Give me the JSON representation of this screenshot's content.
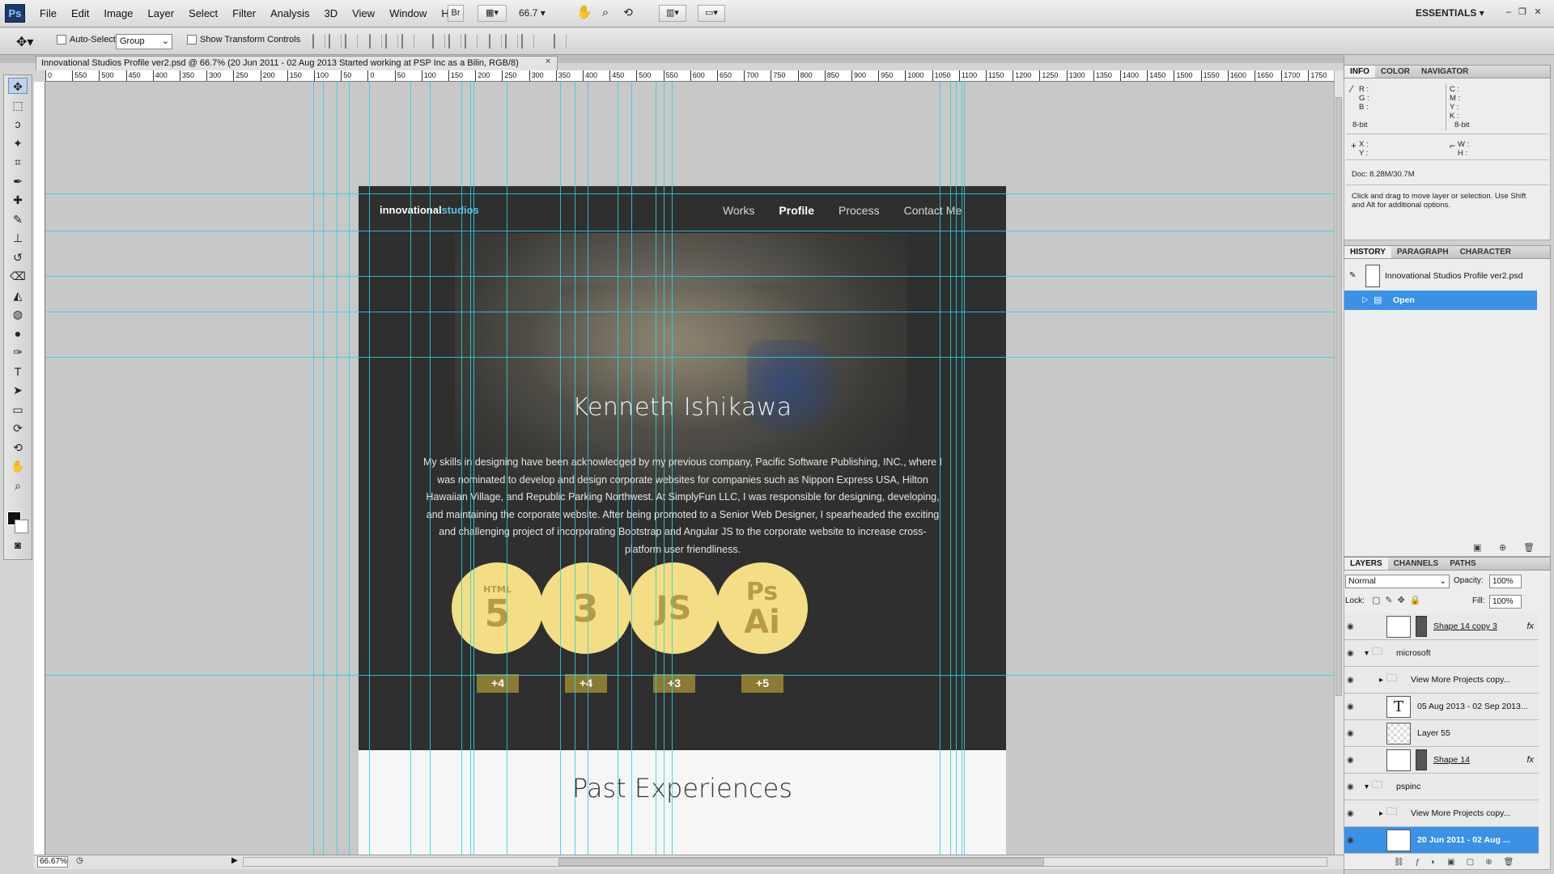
{
  "app": {
    "logo": "Ps",
    "menus": [
      "File",
      "Edit",
      "Image",
      "Layer",
      "Select",
      "Filter",
      "Analysis",
      "3D",
      "View",
      "Window",
      "Help"
    ],
    "zoom_level": "66.7",
    "workspace": "ESSENTIALS",
    "mini_bridge": "Br"
  },
  "options": {
    "auto_select_label": "Auto-Select:",
    "auto_select_value": "Group",
    "transform_label": "Show Transform Controls"
  },
  "document": {
    "tab_title": "Innovational Studios Profile ver2.psd @ 66.7% (20 Jun 2011 - 02 Aug 2013 Started working at PSP Inc as a Bilin, RGB/8)",
    "close": "×",
    "zoom_readout": "66.67%",
    "ruler_labels": [
      "0",
      "550",
      "500",
      "450",
      "400",
      "350",
      "300",
      "250",
      "200",
      "150",
      "100",
      "50",
      "0",
      "50",
      "100",
      "150",
      "200",
      "250",
      "300",
      "350",
      "400",
      "450",
      "500",
      "550",
      "600",
      "650",
      "700",
      "750",
      "800",
      "850",
      "900",
      "950",
      "1000",
      "1050",
      "1100",
      "1150",
      "1200",
      "1250",
      "1300",
      "1350",
      "1400",
      "1450",
      "1500",
      "1550",
      "1600",
      "1650",
      "1700",
      "1750"
    ]
  },
  "design": {
    "logo_a": "innovational",
    "logo_b": "studios",
    "nav": [
      {
        "label": "Works",
        "active": false
      },
      {
        "label": "Profile",
        "active": true
      },
      {
        "label": "Process",
        "active": false
      },
      {
        "label": "Contact Me",
        "active": false
      }
    ],
    "hero_name": "Kenneth Ishikawa",
    "bio": "My skills in designing have been acknowledged by my previous company, Pacific Software Publishing, INC., where I was nominated to develop and design corporate websites for companies such as Nippon Express USA, Hilton Hawaiian Village, and Republic Parking Northwest.  At SimplyFun LLC, I was responsible for designing, developing, and maintaining the corporate website. After being promoted to a Senior Web Designer, I spearheaded the exciting and challenging project of incorporating Bootstrap and Angular JS to the corporate website to increase cross-platform user friendliness.",
    "skills": [
      {
        "icon": "html5-icon",
        "glyph_top": "HTML",
        "glyph": "5",
        "count": "+4"
      },
      {
        "icon": "css3-icon",
        "glyph_top": "",
        "glyph": "3",
        "count": "+4"
      },
      {
        "icon": "js-icon",
        "glyph_top": "",
        "glyph": "JS",
        "count": "+3"
      },
      {
        "icon": "ps-ai-icon",
        "glyph_top": "Ps",
        "glyph": "Ai",
        "count": "+5"
      }
    ],
    "past_title": "Past Experiences",
    "colors": {
      "dark": "#2f2f2f",
      "accent": "#5bc4e6",
      "badge": "#f3de85",
      "guide": "#27d3e0"
    }
  },
  "info_panel": {
    "tabs": [
      "INFO",
      "COLOR",
      "NAVIGATOR"
    ],
    "r": "R :",
    "g": "G :",
    "b": "B :",
    "c": "C :",
    "m": "M :",
    "y": "Y :",
    "k": "K :",
    "bit_a": "8-bit",
    "bit_b": "8-bit",
    "x": "X :",
    "yy": "Y :",
    "w": "W :",
    "h": "H :",
    "doc": "Doc: 8.28M/30.7M",
    "hint": "Click and drag to move layer or selection.  Use Shift and Alt for additional options."
  },
  "history_panel": {
    "tabs": [
      "HISTORY",
      "PARAGRAPH",
      "CHARACTER"
    ],
    "snapshot": "Innovational Studios Profile ver2.psd",
    "state": "Open"
  },
  "layers_panel": {
    "tabs": [
      "LAYERS",
      "CHANNELS",
      "PATHS"
    ],
    "blend": "Normal",
    "opacity_label": "Opacity:",
    "opacity": "100%",
    "lock_label": "Lock:",
    "fill_label": "Fill:",
    "fill": "100%",
    "layers": [
      {
        "name": "Shape 14 copy 3",
        "type": "shape",
        "indent": 2,
        "fx": "fx",
        "selected": false
      },
      {
        "name": "microsoft",
        "type": "group",
        "indent": 1,
        "fx": "",
        "selected": false
      },
      {
        "name": "View More Projects copy...",
        "type": "folder",
        "indent": 2,
        "fx": "",
        "selected": false
      },
      {
        "name": "05 Aug 2013 - 02 Sep 2013...",
        "type": "text",
        "indent": 2,
        "fx": "",
        "selected": false
      },
      {
        "name": "Layer 55",
        "type": "pixel",
        "indent": 2,
        "fx": "",
        "selected": false
      },
      {
        "name": "Shape 14",
        "type": "shape",
        "indent": 2,
        "fx": "fx",
        "selected": false
      },
      {
        "name": "pspinc",
        "type": "group",
        "indent": 1,
        "fx": "",
        "selected": false
      },
      {
        "name": "View More Projects copy...",
        "type": "folder",
        "indent": 2,
        "fx": "",
        "selected": false
      },
      {
        "name": "20 Jun 2011 - 02 Aug ...",
        "type": "text",
        "indent": 2,
        "fx": "",
        "selected": true
      }
    ]
  }
}
